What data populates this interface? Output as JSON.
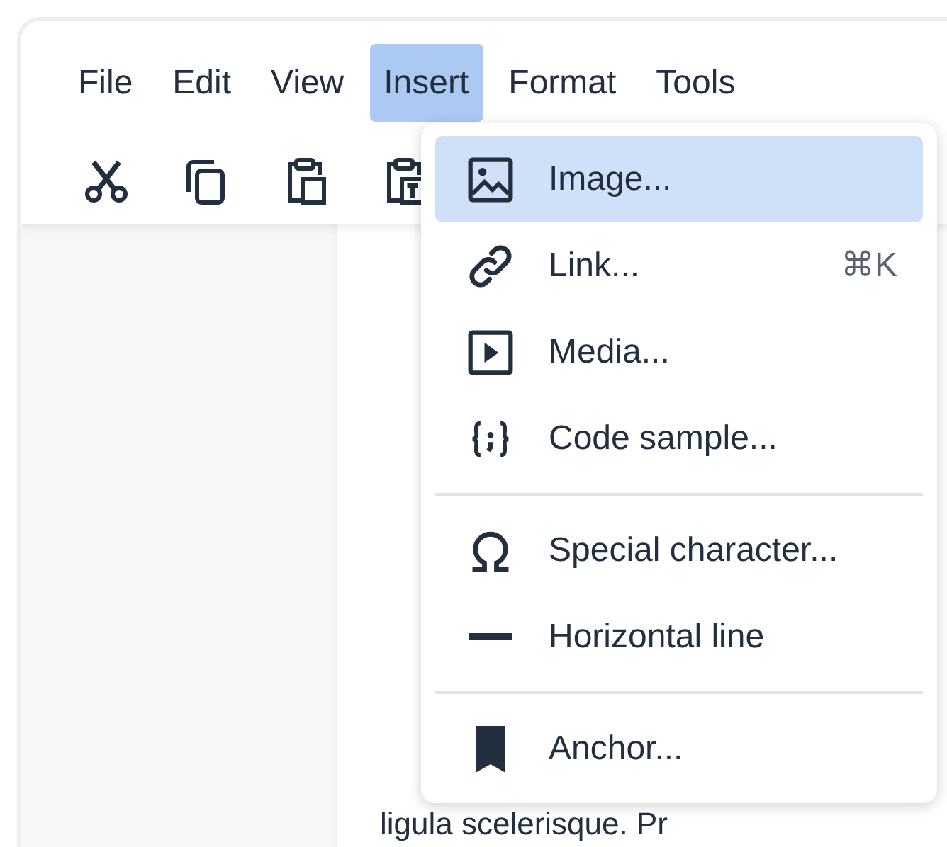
{
  "menubar": [
    {
      "label": "File",
      "selected": false
    },
    {
      "label": "Edit",
      "selected": false
    },
    {
      "label": "View",
      "selected": false
    },
    {
      "label": "Insert",
      "selected": true
    },
    {
      "label": "Format",
      "selected": false
    },
    {
      "label": "Tools",
      "selected": false
    }
  ],
  "toolbar": [
    {
      "kind": "cut"
    },
    {
      "kind": "copy"
    },
    {
      "kind": "paste"
    },
    {
      "kind": "paste-text"
    }
  ],
  "document": {
    "text": "ligula scelerisque. Pr"
  },
  "menu": [
    {
      "kind": "image",
      "label": "Image...",
      "selected": true
    },
    {
      "kind": "link",
      "label": "Link...",
      "shortcut": "⌘K",
      "selected": false
    },
    {
      "kind": "media",
      "label": "Media...",
      "selected": false
    },
    {
      "kind": "code",
      "label": "Code sample...",
      "selected": false
    },
    {
      "kind": "separator"
    },
    {
      "kind": "omega",
      "label": "Special character...",
      "selected": false
    },
    {
      "kind": "hr",
      "label": "Horizontal line",
      "selected": false
    },
    {
      "kind": "separator"
    },
    {
      "kind": "bookmark",
      "label": "Anchor...",
      "selected": false
    }
  ]
}
